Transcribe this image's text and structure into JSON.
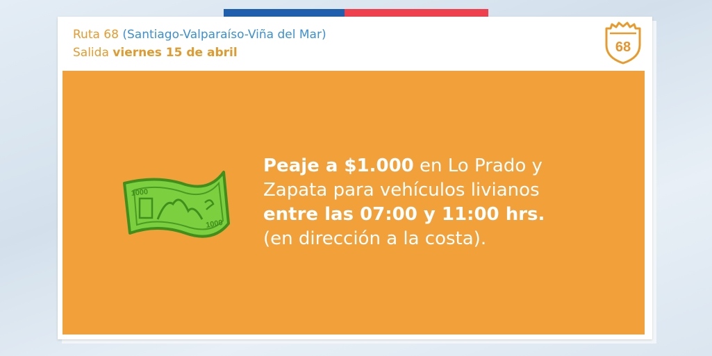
{
  "header": {
    "route_prefix": "Ruta 68",
    "route_detail": "(Santiago-Valparaíso-Viña del Mar)",
    "departure_label": "Salida",
    "departure_date": "viernes 15 de abril",
    "shield_number": "68"
  },
  "bill": {
    "denomination": "1000"
  },
  "message": {
    "line1_bold": "Peaje a $1.000",
    "line1_rest": "en Lo Prado y",
    "line2": "Zapata para vehículos livianos",
    "line3_bold": "entre las 07:00 y 11:00 hrs.",
    "line4": "(en dirección a la costa)."
  },
  "colors": {
    "orange": "#f2a03a",
    "blue": "#1f5fae",
    "red": "#f0404d",
    "header_orange": "#e89a2b",
    "header_blue": "#3a8fd6",
    "bill_green": "#7ccf3f"
  }
}
